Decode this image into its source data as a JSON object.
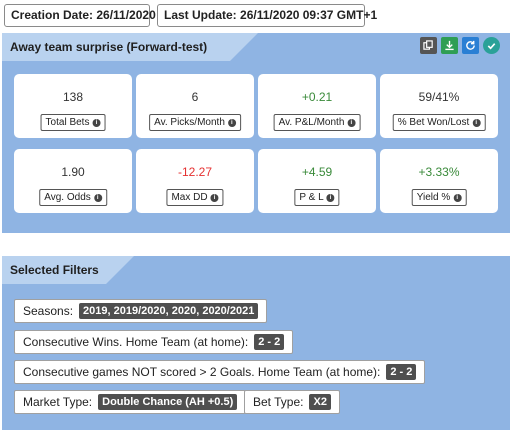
{
  "header": {
    "creation_label": "Creation Date:",
    "creation_value": "26/11/2020",
    "update_label": "Last Update:",
    "update_value": "26/11/2020 09:37 GMT+1"
  },
  "strategy": {
    "title": "Away team surprise (Forward-test)",
    "tools": [
      {
        "icon": "copy-icon",
        "color": "#555555"
      },
      {
        "icon": "download-icon",
        "color": "#2f9e54"
      },
      {
        "icon": "refresh-icon",
        "color": "#2a7fd4"
      },
      {
        "icon": "check-follow-icon",
        "color": "#2aa198"
      }
    ]
  },
  "stats": [
    {
      "value": "138",
      "label": "Total Bets",
      "tone": "neutral"
    },
    {
      "value": "6",
      "label": "Av. Picks/Month",
      "tone": "neutral"
    },
    {
      "value": "+0.21",
      "label": "Av. P&L/Month",
      "tone": "positive"
    },
    {
      "value": "59/41%",
      "label": "% Bet Won/Lost",
      "tone": "neutral"
    },
    {
      "value": "1.90",
      "label": "Avg. Odds",
      "tone": "neutral"
    },
    {
      "value": "-12.27",
      "label": "Max DD",
      "tone": "negative"
    },
    {
      "value": "+4.59",
      "label": "P & L",
      "tone": "positive"
    },
    {
      "value": "+3.33%",
      "label": "Yield %",
      "tone": "positive"
    }
  ],
  "filters": {
    "title": "Selected Filters",
    "seasons_label": "Seasons:",
    "seasons_value": "2019, 2019/2020, 2020, 2020/2021",
    "wins_label": "Consecutive Wins. Home Team (at home):",
    "wins_value": "2 - 2",
    "notscored_label": "Consecutive games NOT scored > 2 Goals. Home Team (at home):",
    "notscored_value": "2 - 2",
    "market_label": "Market Type:",
    "market_value": "Double Chance (AH +0.5)",
    "bettype_label": "Bet Type:",
    "bettype_value": "X2"
  },
  "colors": {
    "panel_bg": "#8fb4e3",
    "tab_bg": "#b9d2ef",
    "positive": "#3a8a3a",
    "negative": "#e53030"
  }
}
